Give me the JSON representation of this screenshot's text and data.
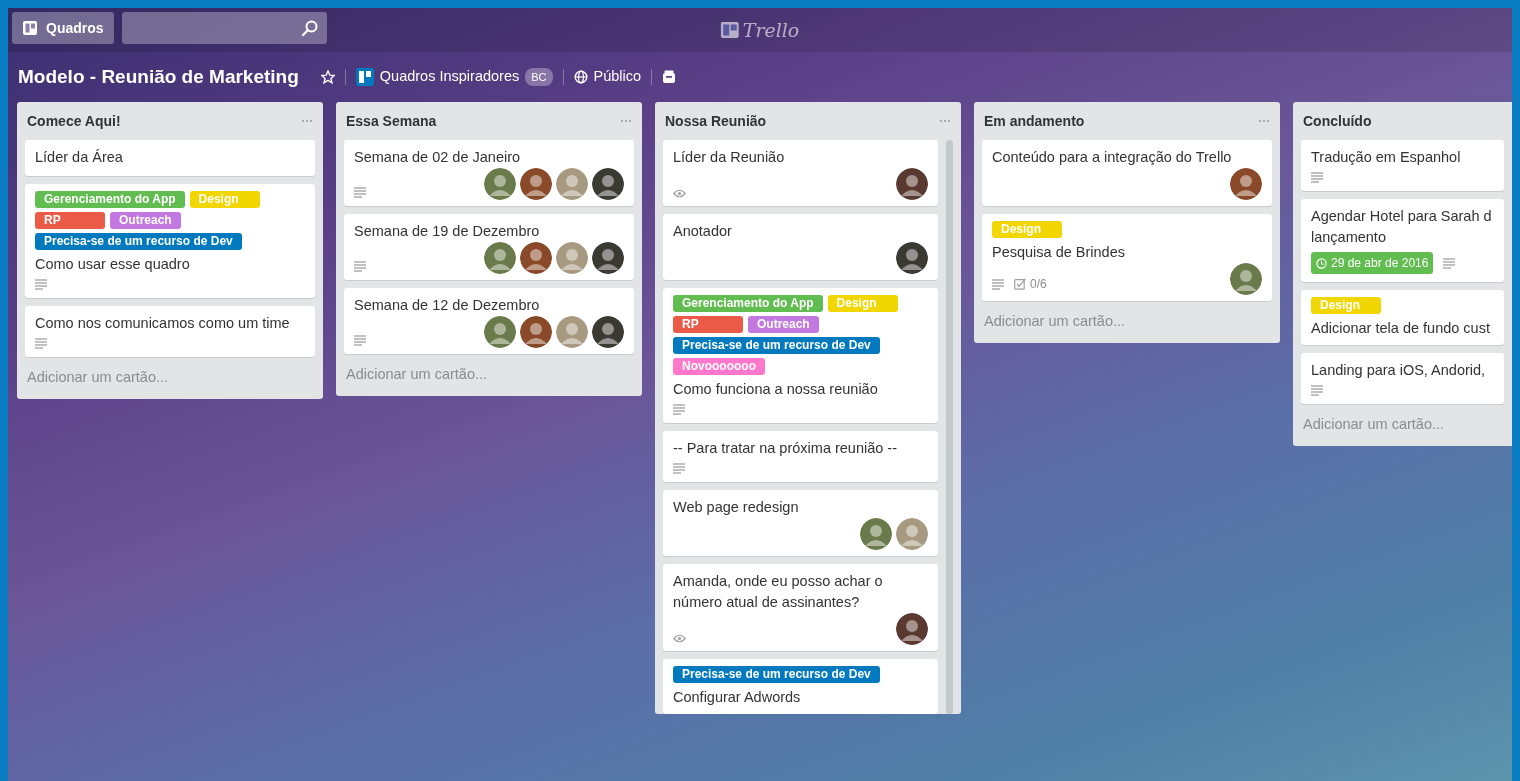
{
  "header": {
    "boards_button": "Quadros",
    "logo": "Trello"
  },
  "board": {
    "title": "Modelo - Reunião de Marketing",
    "team": "Quadros Inspiradores",
    "team_badge": "BC",
    "visibility": "Público"
  },
  "lists": [
    {
      "title": "Comece Aqui!",
      "menu": true,
      "add_card": "Adicionar um cartão...",
      "cards": [
        {
          "title": "Líder da Área"
        },
        {
          "title": "Como usar esse quadro",
          "labels": [
            {
              "text": "Gerenciamento do App",
              "color": "#61bd4f"
            },
            {
              "text": "Design",
              "color": "#f2d600"
            },
            {
              "text": "RP",
              "color": "#eb5a46"
            },
            {
              "text": "Outreach",
              "color": "#c377e0"
            },
            {
              "text": "Precisa-se de um recurso de Dev",
              "color": "#0079bf"
            }
          ],
          "badges": [
            {
              "kind": "description"
            }
          ]
        },
        {
          "title": "Como nos comunicamos como um time",
          "badges": [
            {
              "kind": "description"
            }
          ]
        }
      ]
    },
    {
      "title": "Essa Semana",
      "menu": true,
      "add_card": "Adicionar um cartão...",
      "cards": [
        {
          "title": "Semana de 02 de Janeiro",
          "badges": [
            {
              "kind": "description"
            }
          ],
          "avatars": [
            {
              "color": "#6b7a4a"
            },
            {
              "color": "#8a4a2a"
            },
            {
              "color": "#a89a80"
            },
            {
              "color": "#3a3a32"
            }
          ]
        },
        {
          "title": "Semana de 19 de Dezembro",
          "badges": [
            {
              "kind": "description"
            }
          ],
          "avatars": [
            {
              "color": "#6b7a4a"
            },
            {
              "color": "#8a4a2a"
            },
            {
              "color": "#a89a80"
            },
            {
              "color": "#3a3a32"
            }
          ]
        },
        {
          "title": "Semana de 12 de Dezembro",
          "badges": [
            {
              "kind": "description"
            }
          ],
          "avatars": [
            {
              "color": "#6b7a4a"
            },
            {
              "color": "#8a4a2a"
            },
            {
              "color": "#a89a80"
            },
            {
              "color": "#3a3a32"
            }
          ]
        }
      ]
    },
    {
      "title": "Nossa Reunião",
      "menu": true,
      "scrollbar": true,
      "cards": [
        {
          "title": "Líder da Reunião",
          "badges": [
            {
              "kind": "watch"
            }
          ],
          "avatars": [
            {
              "color": "#5a3a30"
            }
          ]
        },
        {
          "title": "Anotador",
          "avatars": [
            {
              "color": "#3a3a32"
            }
          ]
        },
        {
          "title": "Como funciona a nossa reunião",
          "labels": [
            {
              "text": "Gerenciamento do App",
              "color": "#61bd4f"
            },
            {
              "text": "Design",
              "color": "#f2d600"
            },
            {
              "text": "RP",
              "color": "#eb5a46"
            },
            {
              "text": "Outreach",
              "color": "#c377e0"
            },
            {
              "text": "Precisa-se de um recurso de Dev",
              "color": "#0079bf"
            },
            {
              "text": "Novooooooo",
              "color": "#ff78cb"
            }
          ],
          "badges": [
            {
              "kind": "description"
            }
          ]
        },
        {
          "title": "-- Para tratar na próxima reunião --",
          "badges": [
            {
              "kind": "description"
            }
          ]
        },
        {
          "title": "Web page redesign",
          "avatars": [
            {
              "color": "#6b7a4a"
            },
            {
              "color": "#a89a80"
            }
          ]
        },
        {
          "title": "Amanda, onde eu posso achar o número atual de assinantes?",
          "badges": [
            {
              "kind": "watch"
            }
          ],
          "avatars": [
            {
              "color": "#5a3a30"
            }
          ]
        },
        {
          "title": "Configurar Adwords",
          "labels": [
            {
              "text": "Precisa-se de um recurso de Dev",
              "color": "#0079bf"
            }
          ]
        }
      ]
    },
    {
      "title": "Em andamento",
      "menu": true,
      "add_card": "Adicionar um cartão...",
      "cards": [
        {
          "title": "Conteúdo para a integração do Trello",
          "avatars": [
            {
              "color": "#8a4a2a"
            }
          ]
        },
        {
          "title": "Pesquisa de Brindes",
          "labels": [
            {
              "text": "Design",
              "color": "#f2d600"
            }
          ],
          "badges": [
            {
              "kind": "description"
            },
            {
              "kind": "checklist",
              "text": "0/6"
            }
          ],
          "avatars": [
            {
              "color": "#6b7a4a"
            }
          ]
        }
      ]
    },
    {
      "title": "Concluído",
      "menu": false,
      "add_card": "Adicionar um cartão...",
      "cards": [
        {
          "title": "Tradução em Espanhol",
          "badges": [
            {
              "kind": "description"
            }
          ]
        },
        {
          "title": "Agendar Hotel para Sarah d\nlançamento",
          "badges": [
            {
              "kind": "due",
              "text": "29 de abr de 2016"
            },
            {
              "kind": "description"
            }
          ]
        },
        {
          "title": "Adicionar tela de fundo cust",
          "labels": [
            {
              "text": "Design",
              "color": "#f2d600"
            }
          ]
        },
        {
          "title": "Landing para iOS, Andorid,",
          "badges": [
            {
              "kind": "description"
            }
          ]
        }
      ]
    }
  ]
}
